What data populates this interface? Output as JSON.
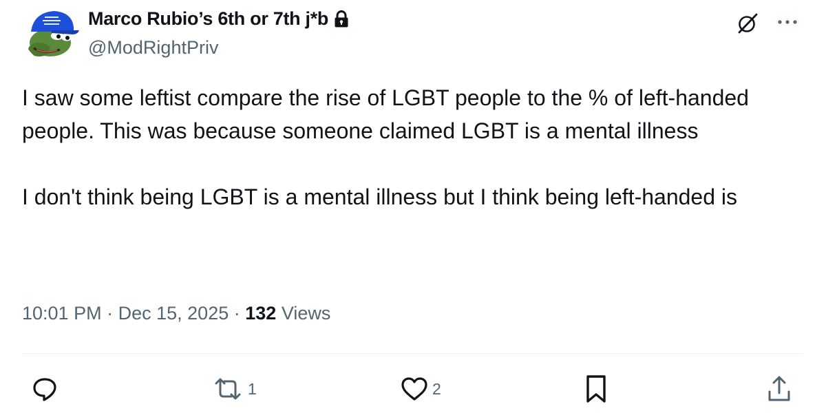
{
  "author": {
    "display_name": "Marco Rubio’s 6th or 7th j*b",
    "handle": "@ModRightPriv",
    "protected": true,
    "avatar_icon": "frog-avatar-blue-cap",
    "avatar_cap_text": "(unreadable text on cap)"
  },
  "tweet": {
    "paragraphs": [
      "I saw some leftist compare the rise of LGBT people to the % of left-handed people. This was because someone claimed LGBT is a mental illness",
      "I don't think being LGBT is a mental illness but I think being left-handed is"
    ],
    "time": "10:01 PM",
    "separator": "·",
    "date": "Dec 15, 2025",
    "views_count": "132",
    "views_label": "Views"
  },
  "actions": {
    "reply_icon": "reply-icon",
    "retweet_icon": "retweet-icon",
    "retweet_count": "1",
    "like_icon": "heart-icon",
    "like_count": "2",
    "bookmark_icon": "bookmark-icon",
    "share_icon": "share-icon"
  },
  "header_icons": {
    "grok": "grok-icon",
    "more": "more-icon"
  },
  "colors": {
    "text_primary": "#0f1419",
    "text_secondary": "#536471",
    "icon_gray": "#536471",
    "divider": "#eff3f4",
    "avatar_cap": "#1d4fd8",
    "avatar_frog": "#5b8a3a"
  }
}
